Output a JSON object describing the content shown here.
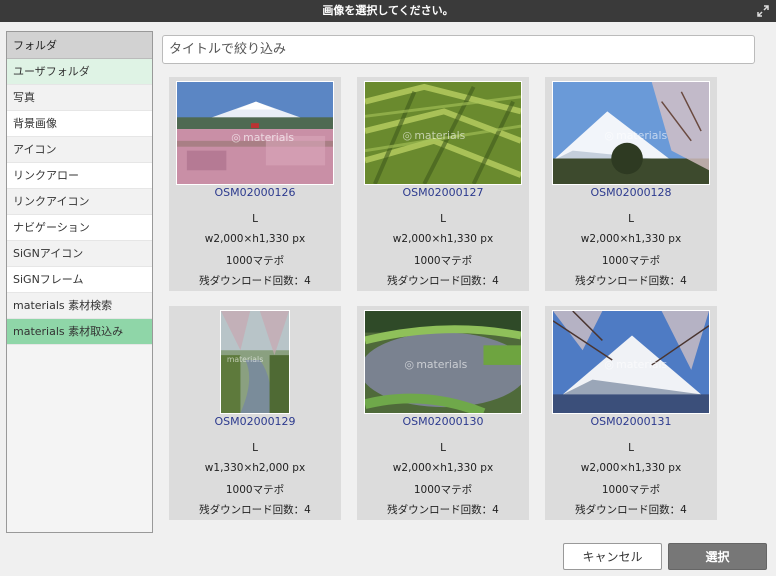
{
  "dialog": {
    "title": "画像を選択してください。"
  },
  "sidebar": {
    "header": "フォルダ",
    "items": [
      {
        "label": "ユーザフォルダ"
      },
      {
        "label": "写真"
      },
      {
        "label": "背景画像"
      },
      {
        "label": "アイコン"
      },
      {
        "label": "リンクアロー"
      },
      {
        "label": "リンクアイコン"
      },
      {
        "label": "ナビゲーション"
      },
      {
        "label": "SiGNアイコン"
      },
      {
        "label": "SiGNフレーム"
      },
      {
        "label": "materials 素材検索"
      },
      {
        "label": "materials 素材取込み"
      }
    ]
  },
  "search": {
    "placeholder": "タイトルで絞り込み",
    "value": ""
  },
  "cards": [
    {
      "code": "OSM02000126",
      "size": "L",
      "dims": "w2,000×h1,330 px",
      "price": "1000マテポ",
      "remaining": "残ダウンロード回数：4"
    },
    {
      "code": "OSM02000127",
      "size": "L",
      "dims": "w2,000×h1,330 px",
      "price": "1000マテポ",
      "remaining": "残ダウンロード回数：4"
    },
    {
      "code": "OSM02000128",
      "size": "L",
      "dims": "w2,000×h1,330 px",
      "price": "1000マテポ",
      "remaining": "残ダウンロード回数：4"
    },
    {
      "code": "OSM02000129",
      "size": "L",
      "dims": "w1,330×h2,000 px",
      "price": "1000マテポ",
      "remaining": "残ダウンロード回数：4"
    },
    {
      "code": "OSM02000130",
      "size": "L",
      "dims": "w2,000×h1,330 px",
      "price": "1000マテポ",
      "remaining": "残ダウンロード回数：4"
    },
    {
      "code": "OSM02000131",
      "size": "L",
      "dims": "w2,000×h1,330 px",
      "price": "1000マテポ",
      "remaining": "残ダウンロード回数：4"
    }
  ],
  "watermark": "materials",
  "footer": {
    "cancel_label": "キャンセル",
    "select_label": "選択"
  },
  "colors": {
    "selected_folder": "#8fd6a8",
    "link_text": "#2c3a8e",
    "titlebar": "#3a3a3a"
  }
}
